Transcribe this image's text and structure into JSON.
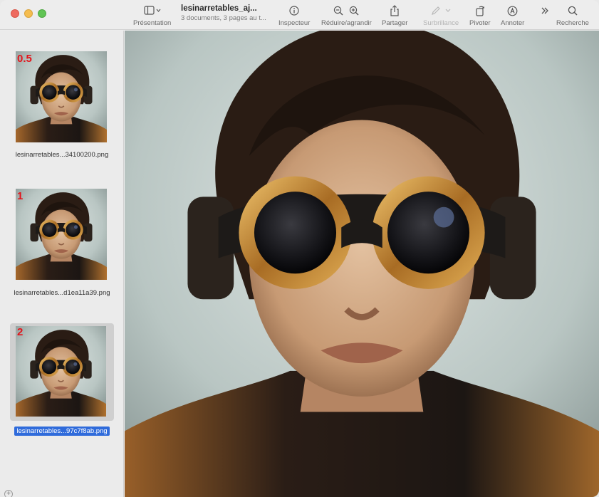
{
  "document": {
    "title": "lesinarretables_aj...",
    "subtitle": "3 documents, 3 pages au t..."
  },
  "toolbar": {
    "presentation": "Présentation",
    "inspector": "Inspecteur",
    "zoom": "Réduire/agrandir",
    "share": "Partager",
    "highlight": "Surbrillance",
    "rotate": "Pivoter",
    "annotate": "Annoter",
    "search": "Recherche"
  },
  "sidebar": {
    "items": [
      {
        "page": "0.5",
        "filename": "lesinarretables...34100200.png",
        "selected": false
      },
      {
        "page": "1",
        "filename": "lesinarretables...d1ea11a39.png",
        "selected": false
      },
      {
        "page": "2",
        "filename": "lesinarretables...97c7f8ab.png",
        "selected": true
      }
    ]
  },
  "icons": {
    "presentation": "sidebar-toggle-icon",
    "inspector": "info-icon",
    "zoom_out": "zoom-out-icon",
    "zoom_in": "zoom-in-icon",
    "share": "share-icon",
    "highlight": "pen-icon",
    "rotate": "rotate-icon",
    "annotate": "markup-icon",
    "more": "chevron-double-right-icon",
    "search": "search-icon"
  },
  "colors": {
    "page_number": "#e3141b",
    "selection": "#2f6bdb"
  }
}
